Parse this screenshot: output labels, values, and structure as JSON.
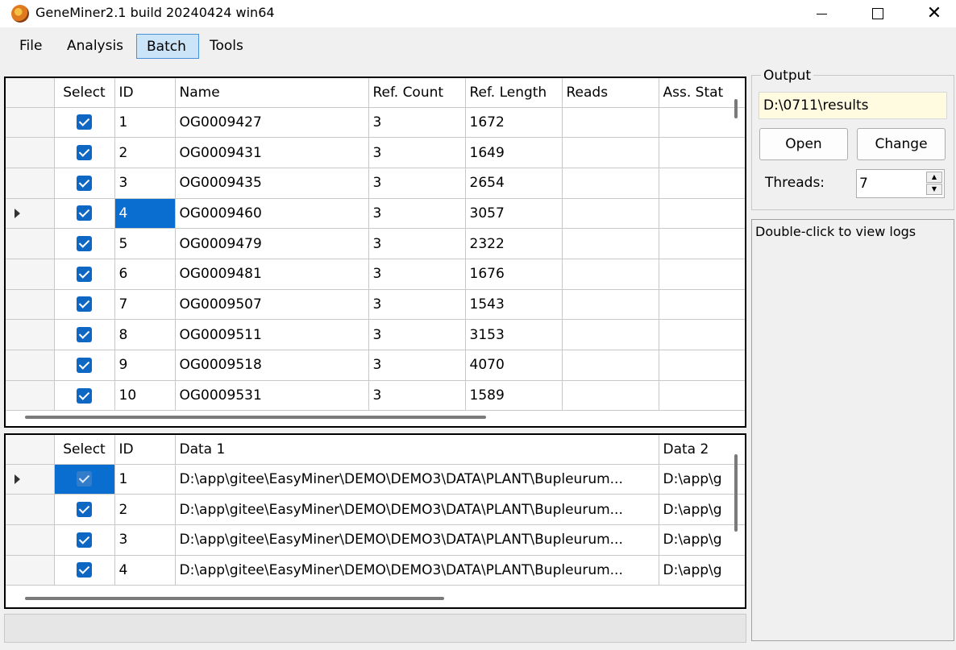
{
  "window": {
    "title": "GeneMiner2.1 build 20240424 win64"
  },
  "menu": [
    "File",
    "Analysis",
    "Batch",
    "Tools"
  ],
  "genes": {
    "columns": [
      "Select",
      "ID",
      "Name",
      "Ref. Count",
      "Ref. Length",
      "Reads",
      "Ass. Stat"
    ],
    "rows": [
      {
        "id": "1",
        "name": "OG0009427",
        "ref_count": "3",
        "ref_length": "1672"
      },
      {
        "id": "2",
        "name": "OG0009431",
        "ref_count": "3",
        "ref_length": "1649"
      },
      {
        "id": "3",
        "name": "OG0009435",
        "ref_count": "3",
        "ref_length": "2654"
      },
      {
        "id": "4",
        "name": "OG0009460",
        "ref_count": "3",
        "ref_length": "3057"
      },
      {
        "id": "5",
        "name": "OG0009479",
        "ref_count": "3",
        "ref_length": "2322"
      },
      {
        "id": "6",
        "name": "OG0009481",
        "ref_count": "3",
        "ref_length": "1676"
      },
      {
        "id": "7",
        "name": "OG0009507",
        "ref_count": "3",
        "ref_length": "1543"
      },
      {
        "id": "8",
        "name": "OG0009511",
        "ref_count": "3",
        "ref_length": "3153"
      },
      {
        "id": "9",
        "name": "OG0009518",
        "ref_count": "3",
        "ref_length": "4070"
      },
      {
        "id": "10",
        "name": "OG0009531",
        "ref_count": "3",
        "ref_length": "1589"
      }
    ]
  },
  "samples": {
    "columns": [
      "Select",
      "ID",
      "Data 1",
      "Data 2"
    ],
    "rows": [
      {
        "id": "1",
        "data1": "D:\\app\\gitee\\EasyMiner\\DEMO\\DEMO3\\DATA\\PLANT\\Bupleurum...",
        "data2": "D:\\app\\g"
      },
      {
        "id": "2",
        "data1": "D:\\app\\gitee\\EasyMiner\\DEMO\\DEMO3\\DATA\\PLANT\\Bupleurum...",
        "data2": "D:\\app\\g"
      },
      {
        "id": "3",
        "data1": "D:\\app\\gitee\\EasyMiner\\DEMO\\DEMO3\\DATA\\PLANT\\Bupleurum...",
        "data2": "D:\\app\\g"
      },
      {
        "id": "4",
        "data1": "D:\\app\\gitee\\EasyMiner\\DEMO\\DEMO3\\DATA\\PLANT\\Bupleurum...",
        "data2": "D:\\app\\g"
      }
    ]
  },
  "output": {
    "label": "Output",
    "path": "D:\\0711\\results",
    "open_label": "Open",
    "change_label": "Change",
    "threads_label": "Threads:",
    "threads_value": "7"
  },
  "log": {
    "hint": "Double-click to view logs"
  },
  "colors": {
    "selection": "#0a6ed1",
    "checkbox": "#0f67c4",
    "path_field": "#fffbe0",
    "menu_active": "#cce4f7"
  }
}
